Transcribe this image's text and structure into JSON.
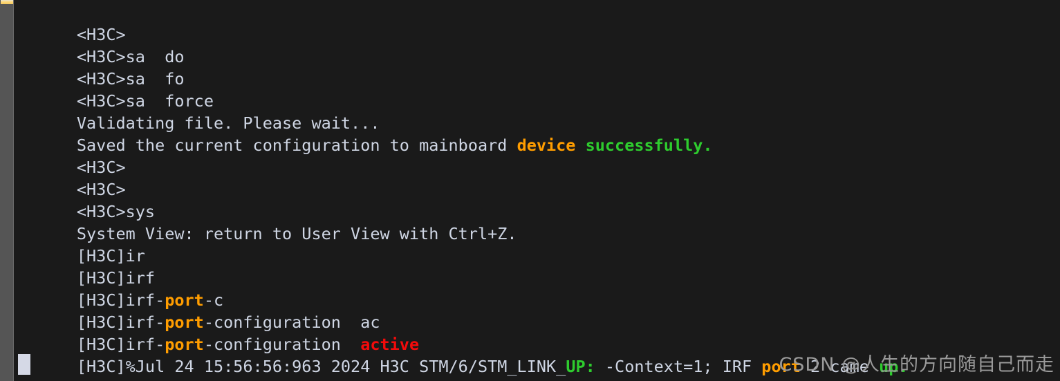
{
  "terminal": {
    "background_color": "#1a1a1a",
    "default_text_color": "#cfd6e4",
    "accent_colors": {
      "orange": "#ff9d00",
      "green": "#2ecc2e",
      "red": "#f40b0b",
      "gutter": "#555555",
      "scroll_thumb": "#ffd978",
      "cursor": "#d5d9e6",
      "watermark": "#9a9a9a"
    },
    "lines": [
      {
        "id": "l1",
        "text": "<H3C>"
      },
      {
        "id": "l2",
        "text": "<H3C>sa  do"
      },
      {
        "id": "l3",
        "text": "<H3C>sa  fo"
      },
      {
        "id": "l4",
        "text": "<H3C>sa  force"
      },
      {
        "id": "l5",
        "text": "Validating file. Please wait..."
      },
      {
        "id": "l6",
        "seg_a": "Saved the current configuration to mainboard ",
        "seg_b": "device",
        "seg_c": " ",
        "seg_d": "successfully."
      },
      {
        "id": "l7",
        "text": "<H3C>"
      },
      {
        "id": "l8",
        "text": "<H3C>"
      },
      {
        "id": "l9",
        "text": "<H3C>sys"
      },
      {
        "id": "l10",
        "text": "System View: return to User View with Ctrl+Z."
      },
      {
        "id": "l11",
        "text": "[H3C]ir"
      },
      {
        "id": "l12",
        "text": "[H3C]irf"
      },
      {
        "id": "l13",
        "seg_a": "[H3C]irf-",
        "seg_b": "port",
        "seg_c": "-c"
      },
      {
        "id": "l14",
        "seg_a": "[H3C]irf-",
        "seg_b": "port",
        "seg_c": "-configuration  ac"
      },
      {
        "id": "l15",
        "seg_a": "[H3C]irf-",
        "seg_b": "port",
        "seg_c": "-configuration  ",
        "seg_d": "active"
      },
      {
        "id": "l16",
        "seg_a": "[H3C]%Jul 24 15:56:56:963 2024 H3C STM/6/STM_LINK_",
        "seg_b": "UP:",
        "seg_c": " -Context=1; IRF ",
        "seg_d": "port",
        "seg_e": " 2 came ",
        "seg_f": "up."
      }
    ]
  },
  "watermark": {
    "text": "CSDN @人生的方向随自己而走"
  }
}
